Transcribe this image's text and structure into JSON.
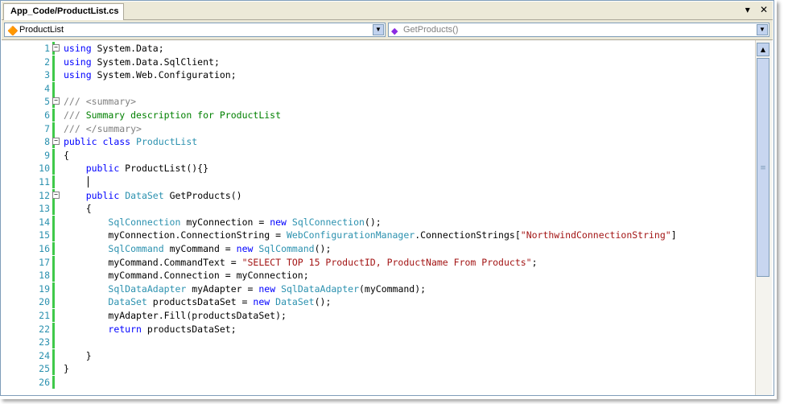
{
  "tab": {
    "title": "App_Code/ProductList.cs",
    "dropdown_glyph": "▾",
    "close_glyph": "✕"
  },
  "navbar": {
    "type_combo": "ProductList",
    "member_combo": "GetProducts()"
  },
  "editor": {
    "lines": [
      {
        "n": "1",
        "code": "<span class=\"k\">using</span> System.Data;"
      },
      {
        "n": "2",
        "code": "<span class=\"k\">using</span> System.Data.SqlClient;"
      },
      {
        "n": "3",
        "code": "<span class=\"k\">using</span> System.Web.Configuration;"
      },
      {
        "n": "4",
        "code": ""
      },
      {
        "n": "5",
        "code": "<span class=\"g\">///</span><span class=\"c\"> </span><span class=\"g\">&lt;summary&gt;</span>"
      },
      {
        "n": "6",
        "code": "<span class=\"g\">///</span><span class=\"c\"> Summary description for ProductList</span>"
      },
      {
        "n": "7",
        "code": "<span class=\"g\">///</span><span class=\"c\"> </span><span class=\"g\">&lt;/summary&gt;</span>"
      },
      {
        "n": "8",
        "code": "<span class=\"k\">public</span> <span class=\"k\">class</span> <span class=\"t\">ProductList</span>"
      },
      {
        "n": "9",
        "code": "{"
      },
      {
        "n": "10",
        "code": "    <span class=\"k\">public</span> ProductList(){}"
      },
      {
        "n": "11",
        "code": ""
      },
      {
        "n": "12",
        "code": "    <span class=\"k\">public</span> <span class=\"t\">DataSet</span> GetProducts()"
      },
      {
        "n": "13",
        "code": "    {"
      },
      {
        "n": "14",
        "code": "        <span class=\"t\">SqlConnection</span> myConnection = <span class=\"k\">new</span> <span class=\"t\">SqlConnection</span>();"
      },
      {
        "n": "15",
        "code": "        myConnection.ConnectionString = <span class=\"t\">WebConfigurationManager</span>.ConnectionStrings[<span class=\"s\">\"NorthwindConnectionString\"</span>]"
      },
      {
        "n": "16",
        "code": "        <span class=\"t\">SqlCommand</span> myCommand = <span class=\"k\">new</span> <span class=\"t\">SqlCommand</span>();"
      },
      {
        "n": "17",
        "code": "        myCommand.CommandText = <span class=\"s\">\"SELECT TOP 15 ProductID, ProductName From Products\"</span>;"
      },
      {
        "n": "18",
        "code": "        myCommand.Connection = myConnection;"
      },
      {
        "n": "19",
        "code": "        <span class=\"t\">SqlDataAdapter</span> myAdapter = <span class=\"k\">new</span> <span class=\"t\">SqlDataAdapter</span>(myCommand);"
      },
      {
        "n": "20",
        "code": "        <span class=\"t\">DataSet</span> productsDataSet = <span class=\"k\">new</span> <span class=\"t\">DataSet</span>();"
      },
      {
        "n": "21",
        "code": "        myAdapter.Fill(productsDataSet);"
      },
      {
        "n": "22",
        "code": "        <span class=\"k\">return</span> productsDataSet;"
      },
      {
        "n": "23",
        "code": ""
      },
      {
        "n": "24",
        "code": "    }"
      },
      {
        "n": "25",
        "code": "}"
      },
      {
        "n": "26",
        "code": ""
      }
    ],
    "fold_lines": [
      "1",
      "5",
      "8",
      "12"
    ],
    "fold_ends": [
      "3",
      "7",
      "24",
      "25"
    ]
  }
}
